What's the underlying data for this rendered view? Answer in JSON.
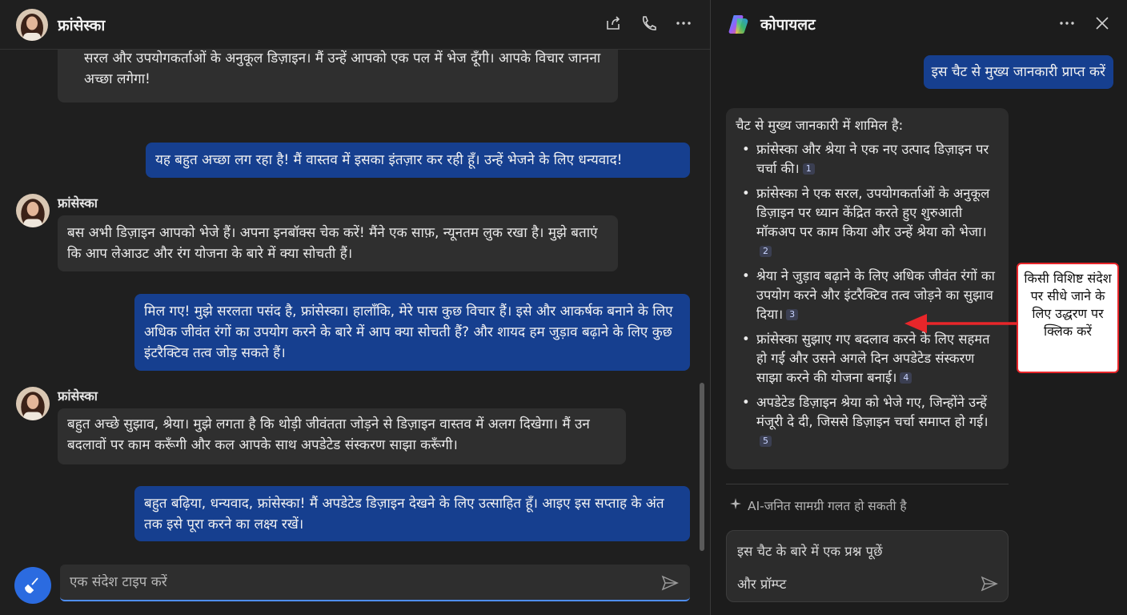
{
  "chat": {
    "contact_name": "फ्रांसेस्का",
    "messages": [
      {
        "sender": "",
        "text": "सरल और उपयोगकर्ताओं के अनुकूल डिज़ाइन। मैं उन्हें आपको एक पल में भेज दूँगी। आपके विचार जानना अच्छा लगेगा!"
      },
      {
        "sender": "",
        "text": "यह बहुत अच्छा लग रहा है! मैं वास्तव में इसका इंतज़ार कर रही हूँ। उन्हें भेजने के लिए धन्यवाद!"
      },
      {
        "sender": "फ्रांसेस्का",
        "text": "बस अभी डिज़ाइन आपको भेजे हैं। अपना इनबॉक्स चेक करें! मैंने एक साफ़, न्यूनतम लुक रखा है। मुझे बताएं कि आप लेआउट और रंग योजना के बारे में क्या सोचती हैं।"
      },
      {
        "sender": "",
        "text": "मिल गए! मुझे सरलता पसंद है, फ्रांसेस्का। हालाँकि, मेरे पास कुछ विचार हैं। इसे और आकर्षक बनाने के लिए अधिक जीवंत रंगों का उपयोग करने के बारे में आप क्या सोचती हैं? और शायद हम जुड़ाव बढ़ाने के लिए कुछ इंटरैक्टिव तत्व जोड़ सकते हैं।"
      },
      {
        "sender": "फ्रांसेस्का",
        "text": "बहुत अच्छे सुझाव, श्रेया। मुझे लगता है कि थोड़ी जीवंतता जोड़ने से डिज़ाइन वास्तव में अलग दिखेगा। मैं उन बदलावों पर काम करूँगी और कल आपके साथ अपडेटेड संस्करण साझा करूँगी।"
      },
      {
        "sender": "",
        "text": "बहुत बढ़िया, धन्यवाद, फ्रांसेस्का! मैं अपडेटेड डिज़ाइन देखने के लिए उत्साहित हूँ। आइए इस सप्ताह के अंत तक इसे पूरा करने का लक्ष्य रखें।"
      }
    ],
    "compose_placeholder": "एक संदेश टाइप करें"
  },
  "copilot": {
    "title": "कोपायलट",
    "user_prompt": "इस चैट से मुख्य जानकारी प्राप्त करें",
    "answer_intro": "चैट से मुख्य जानकारी में शामिल है:",
    "points": [
      {
        "text": "फ्रांसेस्का और श्रेया ने एक नए उत्पाद डिज़ाइन पर चर्चा की।",
        "cite": "1"
      },
      {
        "text": "फ्रांसेस्का ने एक सरल, उपयोगकर्ताओं के अनुकूल डिज़ाइन पर ध्यान केंद्रित करते हुए शुरुआती मॉकअप पर काम किया और उन्हें श्रेया को भेजा।",
        "cite": "2"
      },
      {
        "text": "श्रेया ने जुड़ाव बढ़ाने के लिए अधिक जीवंत रंगों का उपयोग करने और इंटरैक्टिव तत्व जोड़ने का सुझाव दिया।",
        "cite": "3"
      },
      {
        "text": "फ्रांसेस्का सुझाए गए बदलाव करने के लिए सहमत हो गई और उसने अगले दिन अपडेटेड संस्करण साझा करने की योजना बनाई।",
        "cite": "4"
      },
      {
        "text": "अपडेटेड डिज़ाइन श्रेया को भेजे गए, जिन्होंने उन्हें मंजूरी दे दी, जिससे डिज़ाइन चर्चा समाप्त हो गई।",
        "cite": "5"
      }
    ],
    "disclaimer": "AI-जनित सामग्री गलत हो सकती है",
    "input_line1": "इस चैट के बारे में एक प्रश्न पूछें",
    "input_line2": "और प्रॉम्प्ट"
  },
  "annotation": {
    "text": "किसी विशिष्ट संदेश पर सीधे जाने के लिए उद्धरण पर क्लिक करें"
  },
  "colors": {
    "outgoing_bubble": "#163f8f",
    "incoming_bubble": "#2f2f2f",
    "accent": "#2b6be0",
    "annotation_border": "#e8262a"
  }
}
